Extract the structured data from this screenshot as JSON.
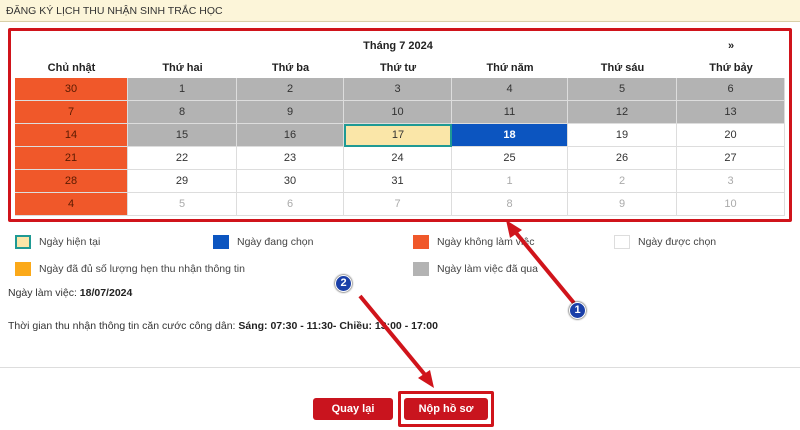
{
  "header": {
    "title": "ĐĂNG KÝ LỊCH THU NHẬN SINH TRẮC HỌC"
  },
  "calendar": {
    "month_label": "Tháng 7 2024",
    "next_label": "»",
    "weekdays": [
      "Chủ nhật",
      "Thứ hai",
      "Thứ ba",
      "Thứ tư",
      "Thứ năm",
      "Thứ sáu",
      "Thứ bảy"
    ],
    "weeks": [
      [
        {
          "d": "30",
          "s": "off"
        },
        {
          "d": "1",
          "s": "past"
        },
        {
          "d": "2",
          "s": "past"
        },
        {
          "d": "3",
          "s": "past"
        },
        {
          "d": "4",
          "s": "past"
        },
        {
          "d": "5",
          "s": "past"
        },
        {
          "d": "6",
          "s": "past"
        }
      ],
      [
        {
          "d": "7",
          "s": "off"
        },
        {
          "d": "8",
          "s": "past"
        },
        {
          "d": "9",
          "s": "past"
        },
        {
          "d": "10",
          "s": "past"
        },
        {
          "d": "11",
          "s": "past"
        },
        {
          "d": "12",
          "s": "past"
        },
        {
          "d": "13",
          "s": "past"
        }
      ],
      [
        {
          "d": "14",
          "s": "off"
        },
        {
          "d": "15",
          "s": "past"
        },
        {
          "d": "16",
          "s": "past"
        },
        {
          "d": "17",
          "s": "cur"
        },
        {
          "d": "18",
          "s": "sel"
        },
        {
          "d": "19",
          "s": ""
        },
        {
          "d": "20",
          "s": ""
        }
      ],
      [
        {
          "d": "21",
          "s": "off"
        },
        {
          "d": "22",
          "s": ""
        },
        {
          "d": "23",
          "s": ""
        },
        {
          "d": "24",
          "s": ""
        },
        {
          "d": "25",
          "s": ""
        },
        {
          "d": "26",
          "s": ""
        },
        {
          "d": "27",
          "s": ""
        }
      ],
      [
        {
          "d": "28",
          "s": "off"
        },
        {
          "d": "29",
          "s": ""
        },
        {
          "d": "30",
          "s": ""
        },
        {
          "d": "31",
          "s": ""
        },
        {
          "d": "1",
          "s": "oth"
        },
        {
          "d": "2",
          "s": "oth"
        },
        {
          "d": "3",
          "s": "oth"
        }
      ],
      [
        {
          "d": "4",
          "s": "off"
        },
        {
          "d": "5",
          "s": "oth"
        },
        {
          "d": "6",
          "s": "oth"
        },
        {
          "d": "7",
          "s": "oth"
        },
        {
          "d": "8",
          "s": "oth"
        },
        {
          "d": "9",
          "s": "oth"
        },
        {
          "d": "10",
          "s": "oth"
        }
      ]
    ]
  },
  "legend": [
    {
      "label": "Ngày hiện tại",
      "color": "#fae6a8"
    },
    {
      "label": "Ngày đang chọn",
      "color": "#0c55c0"
    },
    {
      "label": "Ngày không làm việc",
      "color": "#f0582a"
    },
    {
      "label": "Ngày được chọn",
      "color": "#ffffff"
    },
    {
      "label": "Ngày đã đủ số lượng hẹn thu nhận thông tin",
      "color": "#fba919"
    },
    {
      "label": "Ngày làm việc đã qua",
      "color": "#b3b3b3"
    }
  ],
  "info": {
    "workday_label": "Ngày làm việc:",
    "workday_value": "18/07/2024",
    "time_label": "Thời gian thu nhận thông tin căn cước công dân:",
    "time_value": "Sáng: 07:30 - 11:30- Chiều: 13:00 - 17:00"
  },
  "buttons": {
    "back": "Quay lại",
    "submit": "Nộp hồ sơ"
  },
  "annotations": {
    "one": "1",
    "two": "2"
  }
}
